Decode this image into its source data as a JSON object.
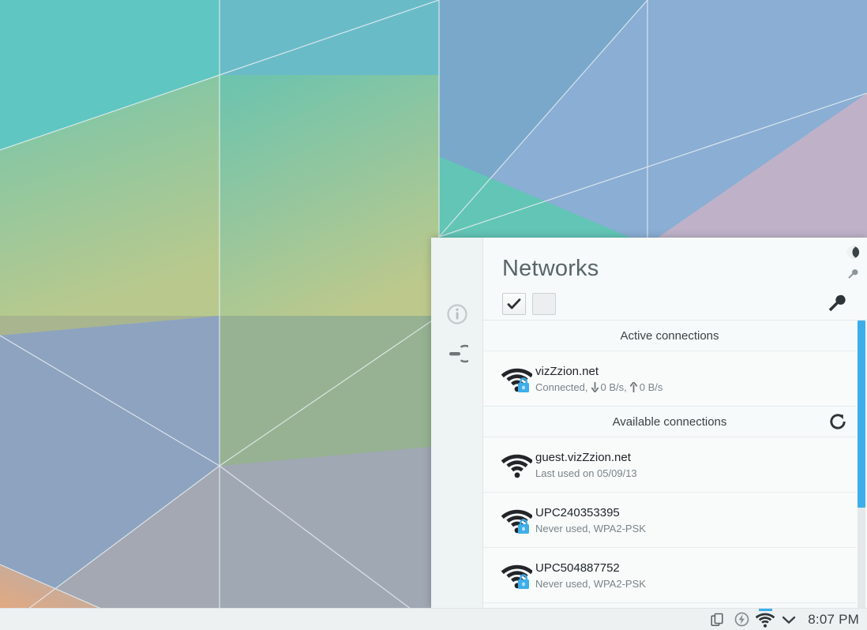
{
  "desktop": {
    "wallpaper_name": "breeze-geometric-wallpaper",
    "colors": {
      "teal": "#63c9bd",
      "green": "#6fc79f",
      "blue": "#7ba4cf",
      "mauve": "#c0aec6",
      "orange": "#e8a878",
      "accent": "#3daee9"
    }
  },
  "popup": {
    "title": "Networks",
    "sidebar": [
      {
        "name": "info-icon",
        "tooltip": "Information"
      },
      {
        "name": "power-connect-icon",
        "tooltip": "Connect"
      }
    ],
    "toolbar": {
      "toggle_checked_label": "✔",
      "toggle_checked_name": "enable-networking-toggle",
      "toggle_empty_name": "enable-wireless-toggle",
      "configure_name": "configure-button",
      "moon_name": "do-not-disturb-icon",
      "wrench_small_name": "settings-icon"
    },
    "sections": [
      {
        "header": "Active connections",
        "has_refresh": false,
        "rows": [
          {
            "name": "vizZzion.net",
            "status_prefix": "Connected,",
            "download": "0 B/s",
            "upload": "0 B/s",
            "secure": true,
            "signal": 4,
            "subtitle": "Connected, ↓ 0 B/s, ↑ 0 B/s"
          }
        ]
      },
      {
        "header": "Available connections",
        "has_refresh": true,
        "refresh_name": "refresh-networks-button",
        "rows": [
          {
            "name": "guest.vizZzion.net",
            "subtitle": "Last used on 05/09/13",
            "secure": false,
            "signal": 4
          },
          {
            "name": "UPC240353395",
            "subtitle": "Never used, WPA2-PSK",
            "secure": true,
            "signal": 4
          },
          {
            "name": "UPC504887752",
            "subtitle": "Never used, WPA2-PSK",
            "secure": true,
            "signal": 4
          }
        ]
      }
    ],
    "scrollbar": {
      "thumb_color": "#3daee9",
      "track_color": "#e4e8e9"
    }
  },
  "taskbar": {
    "tray": [
      {
        "name": "clipboard-icon",
        "active": false
      },
      {
        "name": "battery-icon",
        "active": false
      },
      {
        "name": "wifi-icon",
        "active": true
      },
      {
        "name": "chevron-down-icon",
        "active": false
      }
    ],
    "clock": "8:07 PM"
  }
}
